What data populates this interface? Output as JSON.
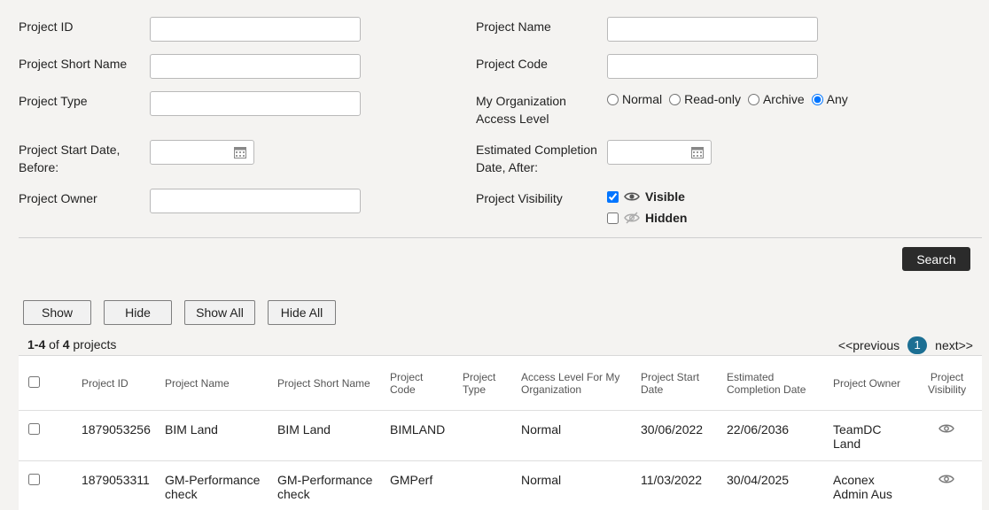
{
  "filters": {
    "project_id_label": "Project ID",
    "project_name_label": "Project Name",
    "project_short_name_label": "Project Short Name",
    "project_code_label": "Project Code",
    "project_type_label": "Project Type",
    "access_level_label_line1": "My Organization",
    "access_level_label_line2": "Access Level",
    "access_options": [
      "Normal",
      "Read-only",
      "Archive",
      "Any"
    ],
    "access_selected": "Any",
    "start_date_label_line1": "Project Start Date,",
    "start_date_label_line2": "Before:",
    "completion_date_label_line1": "Estimated Completion",
    "completion_date_label_line2": "Date, After:",
    "owner_label": "Project Owner",
    "visibility_label": "Project Visibility",
    "visible_label": "Visible",
    "hidden_label": "Hidden",
    "visible_checked": true,
    "hidden_checked": false,
    "search_button": "Search"
  },
  "actions": {
    "show": "Show",
    "hide": "Hide",
    "show_all": "Show All",
    "hide_all": "Hide All"
  },
  "results": {
    "range": "1-4",
    "of": "of",
    "total": "4",
    "unit": "projects",
    "previous": "<<previous",
    "current_page": "1",
    "next": "next>>"
  },
  "table": {
    "headers": {
      "project_id": "Project ID",
      "project_name": "Project Name",
      "short_name": "Project Short Name",
      "code_1": "Project",
      "code_2": "Code",
      "type_1": "Project",
      "type_2": "Type",
      "access_1": "Access Level For My",
      "access_2": "Organization",
      "start_1": "Project Start",
      "start_2": "Date",
      "completion_1": "Estimated",
      "completion_2": "Completion Date",
      "owner": "Project Owner",
      "visibility_1": "Project",
      "visibility_2": "Visibility"
    },
    "rows": [
      {
        "id": "1879053256",
        "name_1": "BIM Land",
        "name_2": "",
        "short_1": "BIM Land",
        "short_2": "",
        "code": "BIMLAND",
        "type": "",
        "access": "Normal",
        "start": "30/06/2022",
        "completion": "22/06/2036",
        "owner_1": "TeamDC",
        "owner_2": "Land"
      },
      {
        "id": "1879053311",
        "name_1": "GM-Performance",
        "name_2": "check",
        "short_1": "GM-Performance",
        "short_2": "check",
        "code": "GMPerf",
        "type": "",
        "access": "Normal",
        "start": "11/03/2022",
        "completion": "30/04/2025",
        "owner_1": "Aconex",
        "owner_2": "Admin Aus"
      }
    ]
  }
}
